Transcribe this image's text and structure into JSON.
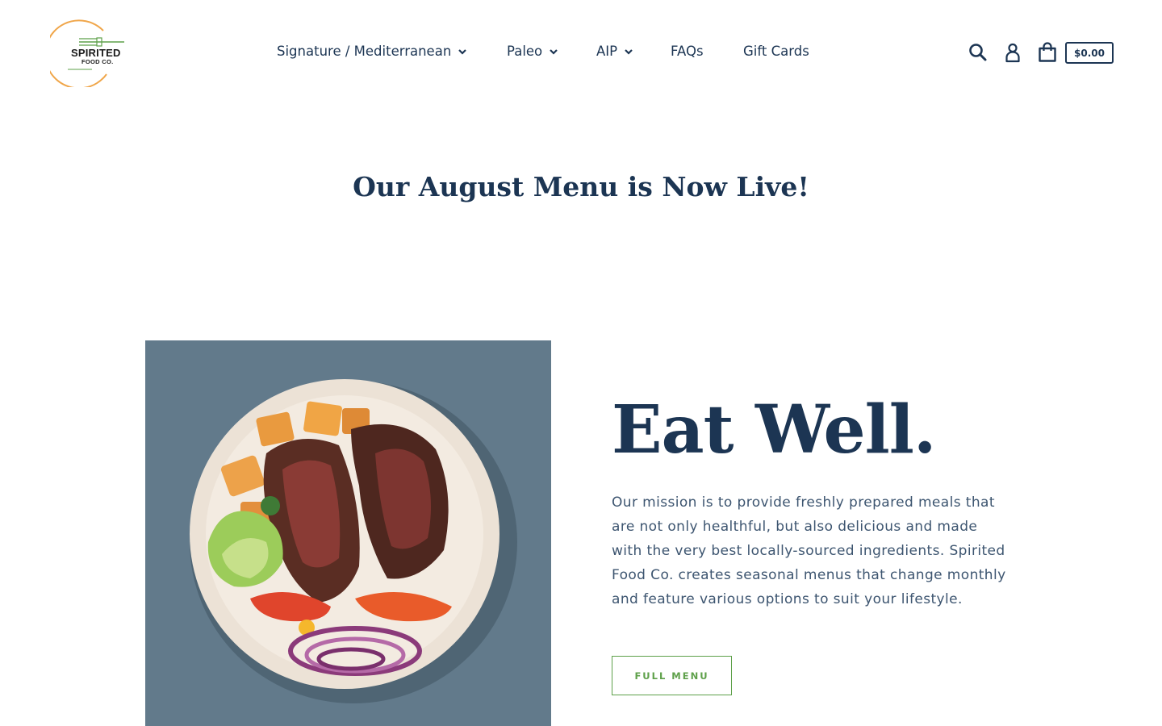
{
  "brand": {
    "name_line1": "SPIRITED",
    "name_line2": "FOOD CO."
  },
  "nav": {
    "items": [
      {
        "label": "Signature / Mediterranean",
        "has_dropdown": true
      },
      {
        "label": "Paleo",
        "has_dropdown": true
      },
      {
        "label": "AIP",
        "has_dropdown": true
      },
      {
        "label": "FAQs",
        "has_dropdown": false
      },
      {
        "label": "Gift Cards",
        "has_dropdown": false
      }
    ]
  },
  "header_icons": {
    "search": "search-icon",
    "account": "account-icon",
    "cart": "cart-icon",
    "cart_total": "$0.00"
  },
  "announcement": {
    "text": "Our August Menu is Now Live!"
  },
  "feature": {
    "title": "Eat Well.",
    "text": "Our mission is to provide freshly prepared meals that are not only healthful, but also delicious and made with the very best locally-sourced ingredients. Spirited Food Co. creates seasonal menus that change monthly and feature various options to suit your lifestyle.",
    "button_label": "FULL MENU",
    "image": "plate-of-steak-salad"
  },
  "colors": {
    "primary": "#1c3553",
    "accent_green": "#5ea04a",
    "logo_orange": "#f0a64a",
    "image_bg": "#627a8b"
  }
}
